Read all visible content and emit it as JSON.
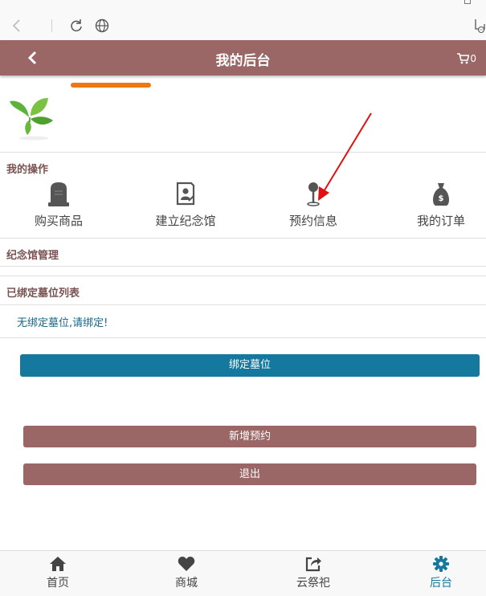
{
  "header": {
    "title": "我的后台",
    "cart_count": "0"
  },
  "sections": {
    "my_operations": "我的操作",
    "memorial_management": "纪念馆管理",
    "bound_tombs": "已绑定墓位列表"
  },
  "operations": [
    {
      "label": "购买商品",
      "icon": "tombstone-icon"
    },
    {
      "label": "建立纪念馆",
      "icon": "memorial-portrait-icon"
    },
    {
      "label": "预约信息",
      "icon": "location-pin-icon"
    },
    {
      "label": "我的订单",
      "icon": "money-bag-icon"
    }
  ],
  "empty_message": "无绑定墓位,请绑定!",
  "buttons": {
    "bind": "绑定墓位",
    "new_reservation": "新增预约",
    "logout": "退出"
  },
  "nav": [
    {
      "label": "首页",
      "icon": "home-icon"
    },
    {
      "label": "商城",
      "icon": "heart-icon"
    },
    {
      "label": "云祭祀",
      "icon": "share-icon"
    },
    {
      "label": "后台",
      "icon": "gear-icon",
      "active": true
    }
  ],
  "colors": {
    "header": "#9b6666",
    "accent_blue": "#15789e",
    "orange": "#ee7711",
    "arrow": "#e01010"
  }
}
